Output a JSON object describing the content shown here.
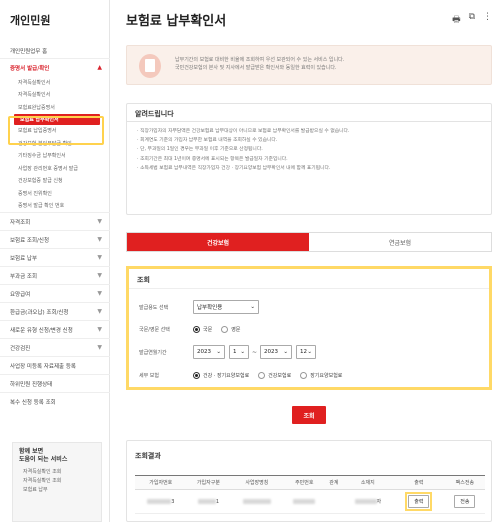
{
  "sidebar": {
    "title": "개인민원",
    "items": [
      {
        "label": "개인민원업무 홈",
        "type": "plain"
      },
      {
        "label": "증명서 발급/확인",
        "type": "major",
        "active": true,
        "chev": "▲"
      },
      {
        "label": "자격득실확인서",
        "type": "sub"
      },
      {
        "label": "자격득실확인서",
        "type": "sub"
      },
      {
        "label": "보험료완납증명서",
        "type": "sub"
      },
      {
        "label": "보험료 납부확인서",
        "type": "sub",
        "selected": true
      },
      {
        "label": "보험료 납입증명서",
        "type": "sub"
      },
      {
        "label": "건강보험 본인부담금 확인",
        "type": "sub"
      },
      {
        "label": "기타징수금 납부확인서",
        "type": "sub"
      },
      {
        "label": "사업장 관리번호 증명서 발급",
        "type": "sub"
      },
      {
        "label": "건강보험증 발급 신청",
        "type": "sub"
      },
      {
        "label": "증명서 진위확인",
        "type": "sub"
      },
      {
        "label": "증명서 발급 확인 번호",
        "type": "sub"
      },
      {
        "label": "자격조회",
        "type": "major",
        "chev": "▼"
      },
      {
        "label": "보험료 조회/신청",
        "type": "major",
        "chev": "▼"
      },
      {
        "label": "보험료 납부",
        "type": "major",
        "chev": "▼"
      },
      {
        "label": "부과금 조회",
        "type": "major",
        "chev": "▼"
      },
      {
        "label": "요양급여",
        "type": "major",
        "chev": "▼"
      },
      {
        "label": "환급금(과오납) 조회/신청",
        "type": "major",
        "chev": "▼"
      },
      {
        "label": "새로운 유형 신청/변경 신청",
        "type": "major",
        "chev": "▼"
      },
      {
        "label": "건강검진",
        "type": "major",
        "chev": "▼"
      },
      {
        "label": "사업장 미등록 자료제출 등록",
        "type": "major"
      },
      {
        "label": "하위민원 진행상태",
        "type": "major"
      },
      {
        "label": "복수 신청 등록 조회",
        "type": "major"
      }
    ],
    "box": {
      "title_line1": "함께 보면",
      "title_line2": "도움이 되는 서비스",
      "links": [
        "자격득실확인 조회",
        "자격득실확인 조회",
        "보험료 납부"
      ]
    }
  },
  "header": {
    "title": "보험료 납부확인서",
    "icons": [
      "print-icon",
      "share-icon",
      "bookmark-icon"
    ]
  },
  "notice": {
    "line1": "납부기간의 보험료 대비한 비율에 조회하여 우선 보관되어 수 있는 서비스 입니다.",
    "line2": "국민건강보험의 본사 및 지사에서 발급받은 확인서와 동일한 효력이 있습니다."
  },
  "info": {
    "title": "알려드립니다",
    "lines": [
      "직장가입자의 자부담액은 건강보험료 납부대상이 아니므로 보험료 납부확인서를 발급받으실 수 없습니다.",
      "회계연도 기준의 가입자 납부한 보험료 내역을 조회하실 수 있습니다.",
      "단, 부과일의 1일인 경우는 부과일 이후 기준으로 산정됩니다.",
      "조회기간은 최대 1년이며 증명서에 표시되는 항목은 발급일자 기준입니다.",
      "소득세법 보험료 납부내역은 직장가입자 건강 · 장기요양보험 납부확인서 내에 함께 표기됩니다."
    ]
  },
  "tabs": [
    {
      "label": "건강보험",
      "active": true
    },
    {
      "label": "연금보험",
      "active": false
    }
  ],
  "query": {
    "title": "조회",
    "rows": {
      "purpose_label": "발급용도 선택",
      "purpose_value": "납부확인용",
      "target_label": "국문/영문 선택",
      "target_options": [
        "국문",
        "영문"
      ],
      "period_label": "발급연월기간",
      "start_year": "2023",
      "start_month": "1",
      "end_year": "2023",
      "end_month": "12",
      "tilde": "~",
      "type_label": "세부 보험",
      "type_options": [
        "건강 · 장기요양보험료",
        "건강보험료",
        "장기요양보험료"
      ]
    },
    "search_label": "조회"
  },
  "results": {
    "title": "조회결과",
    "columns": [
      "가입자번호",
      "가입자구분",
      "사업장명칭",
      "주민번호",
      "관계",
      "소재지",
      "출력",
      "팩스전송"
    ],
    "row": {
      "col2_suffix": "1",
      "col4_suffix": "3",
      "col6_suffix": "자",
      "print_label": "출력",
      "fax_label": "전송"
    }
  }
}
